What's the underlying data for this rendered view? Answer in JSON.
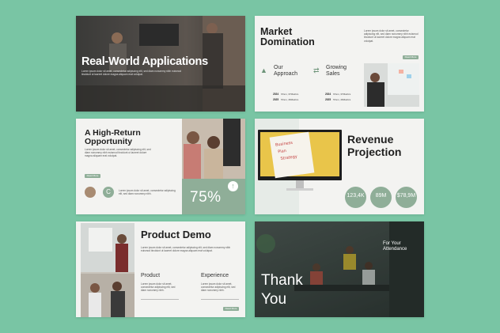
{
  "lorem": "Lorem ipsum dolor sit amet, consectetur adipiscing elit, sed diam nonummy nibh euismod tincidunt ut laoreet dolore magna aliquam erat volutpat.",
  "lorem_short": "Lorem ipsum dolor sit amet, consectetur adipiscing elit, sed diam nonummy nibh.",
  "button_label": "Read More",
  "accent_color": "#8fae98",
  "slide1": {
    "title": "Real-World Applications"
  },
  "slide2": {
    "title_line1": "Market",
    "title_line2": "Domination",
    "col1_line1": "Our",
    "col1_line2": "Approach",
    "col2_line1": "Growing",
    "col2_line2": "Sales",
    "stats": [
      {
        "year": "2024",
        "text": "67am, 37Matrics"
      },
      {
        "year": "2025",
        "text": "57am, 46Matrics"
      },
      {
        "year": "2024",
        "text": "67am, 37Matrics"
      },
      {
        "year": "2025",
        "text": "57am, 46Matrics"
      }
    ]
  },
  "slide3": {
    "title_line1": "A High-Return",
    "title_line2": "Opportunity",
    "percent": "75%",
    "avatar_letter": "C"
  },
  "slide4": {
    "title_line1": "Revenue",
    "title_line2": "Projection",
    "stats": [
      "123,4K",
      "89M",
      "$78,9M"
    ],
    "note_lines": [
      "Business",
      "Plan",
      "Strategy"
    ]
  },
  "slide5": {
    "title": "Product Demo",
    "col1": "Product",
    "col2": "Experience"
  },
  "slide6": {
    "line1": "Thank",
    "line2": "You",
    "attend1": "For Your",
    "attend2": "Attendance"
  }
}
